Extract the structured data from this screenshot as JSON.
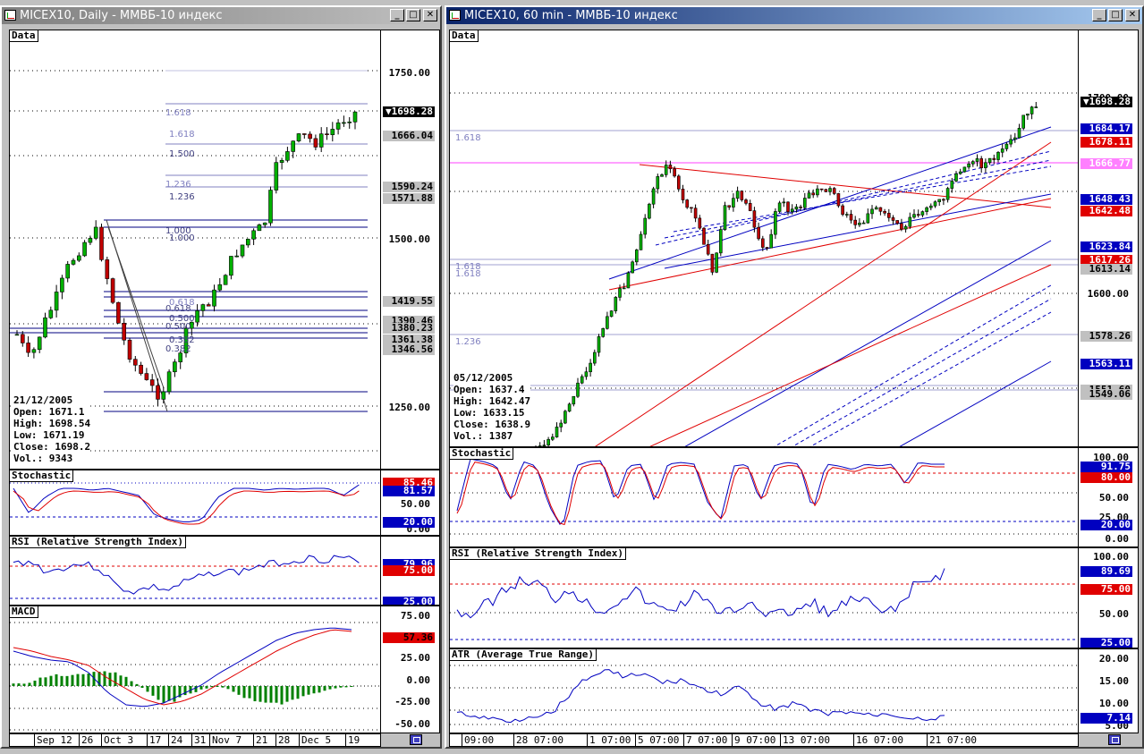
{
  "colors": {
    "active_title": "#0a246a",
    "inactive_title": "#808080",
    "bull": "#00a000",
    "bear": "#c00000",
    "blue": "#0000c0",
    "red": "#e00000"
  },
  "left": {
    "title": "MICEX10, Daily - ММВБ-10 индекс",
    "buttons": {
      "minimize": "_",
      "maximize": "□",
      "close": "✕"
    },
    "price": {
      "label": "Data",
      "ticks": [
        "1750.00",
        "1500.00",
        "1250.00"
      ],
      "badges": [
        {
          "text": "1698.28",
          "bg": "#000000",
          "fg": "#ffffff",
          "arrow": "▼"
        },
        {
          "text": "1666.04",
          "bg": "#c0c0c0",
          "fg": "#000000"
        },
        {
          "text": "1590.24",
          "bg": "#c0c0c0",
          "fg": "#000000"
        },
        {
          "text": "1571.88",
          "bg": "#c0c0c0",
          "fg": "#000000"
        },
        {
          "text": "1419.55",
          "bg": "#c0c0c0",
          "fg": "#000000"
        },
        {
          "text": "1390.46",
          "bg": "#c0c0c0",
          "fg": "#000000"
        },
        {
          "text": "1380.23",
          "bg": "#c0c0c0",
          "fg": "#000000"
        },
        {
          "text": "1361.38",
          "bg": "#c0c0c0",
          "fg": "#000000"
        },
        {
          "text": "1346.56",
          "bg": "#c0c0c0",
          "fg": "#000000"
        }
      ],
      "fib_labels": [
        "1.618",
        "1.618",
        "1.500",
        "1.236",
        "1.236",
        "1.000",
        "1.000",
        "0.618",
        "0.618",
        "0.500",
        "0.500",
        "0.382",
        "0.382"
      ],
      "ohlc": {
        "date": "21/12/2005",
        "open": "Open: 1671.1",
        "high": "High: 1698.54",
        "low": "Low: 1671.19",
        "close": "Close: 1698.2",
        "vol": "Vol.: 9343"
      }
    },
    "stoch": {
      "label": "Stochastic",
      "ticks": [
        "50.00",
        "0.00"
      ],
      "badges": [
        {
          "text": "85.46",
          "bg": "#e00000",
          "fg": "#ffffff"
        },
        {
          "text": "81.57",
          "bg": "#0000c0",
          "fg": "#ffffff"
        },
        {
          "text": "20.00",
          "bg": "#0000c0",
          "fg": "#ffffff"
        }
      ]
    },
    "rsi": {
      "label": "RSI (Relative Strength Index)",
      "badges": [
        {
          "text": "79.96",
          "bg": "#0000c0",
          "fg": "#ffffff"
        },
        {
          "text": "75.00",
          "bg": "#e00000",
          "fg": "#ffffff"
        },
        {
          "text": "25.00",
          "bg": "#0000c0",
          "fg": "#ffffff"
        }
      ]
    },
    "macd": {
      "label": "MACD",
      "ticks": [
        "75.00",
        "25.00",
        "0.00",
        "-25.00",
        "-50.00"
      ],
      "badges": [
        {
          "text": "57.36",
          "bg": "#e00000",
          "fg": "#000000"
        }
      ]
    },
    "xaxis": [
      "Sep 12",
      "26",
      "Oct 3",
      "17",
      "24",
      "31",
      "Nov 7",
      "21",
      "28",
      "Dec 5",
      "19"
    ]
  },
  "right": {
    "title": "MICEX10, 60 min - ММВБ-10 индекс",
    "buttons": {
      "minimize": "_",
      "maximize": "□",
      "close": "✕"
    },
    "price": {
      "label": "Data",
      "ticks": [
        "1700.00",
        "1600.00"
      ],
      "badges": [
        {
          "text": "1698.28",
          "bg": "#000000",
          "fg": "#ffffff",
          "arrow": "▼"
        },
        {
          "text": "1684.17",
          "bg": "#0000c0",
          "fg": "#ffffff"
        },
        {
          "text": "1678.11",
          "bg": "#e00000",
          "fg": "#ffffff"
        },
        {
          "text": "1666.77",
          "bg": "#ff80ff",
          "fg": "#ffffff"
        },
        {
          "text": "1648.43",
          "bg": "#0000c0",
          "fg": "#ffffff"
        },
        {
          "text": "1642.48",
          "bg": "#e00000",
          "fg": "#ffffff"
        },
        {
          "text": "1623.84",
          "bg": "#0000c0",
          "fg": "#ffffff"
        },
        {
          "text": "1617.26",
          "bg": "#e00000",
          "fg": "#ffffff"
        },
        {
          "text": "1613.14",
          "bg": "#c0c0c0",
          "fg": "#000000"
        },
        {
          "text": "1578.26",
          "bg": "#c0c0c0",
          "fg": "#000000"
        },
        {
          "text": "1563.11",
          "bg": "#0000c0",
          "fg": "#ffffff"
        },
        {
          "text": "1551.60",
          "bg": "#c0c0c0",
          "fg": "#000000"
        },
        {
          "text": "1549.06",
          "bg": "#c0c0c0",
          "fg": "#000000"
        }
      ],
      "fib_labels": [
        "1.618",
        "1.618",
        "1.618",
        "1.236"
      ],
      "ohlc": {
        "date": "05/12/2005",
        "open": "Open: 1637.4",
        "high": "High: 1642.47",
        "low": "Low: 1633.15",
        "close": "Close: 1638.9",
        "vol": "Vol.: 1387"
      }
    },
    "stoch": {
      "label": "Stochastic",
      "ticks": [
        "100.00",
        "50.00",
        "25.00",
        "0.00"
      ],
      "badges": [
        {
          "text": "91.75",
          "bg": "#0000c0",
          "fg": "#ffffff"
        },
        {
          "text": "80.00",
          "bg": "#e00000",
          "fg": "#ffffff"
        },
        {
          "text": "20.00",
          "bg": "#0000c0",
          "fg": "#ffffff"
        }
      ]
    },
    "rsi": {
      "label": "RSI (Relative Strength Index)",
      "ticks": [
        "100.00",
        "50.00"
      ],
      "badges": [
        {
          "text": "89.69",
          "bg": "#0000c0",
          "fg": "#ffffff"
        },
        {
          "text": "75.00",
          "bg": "#e00000",
          "fg": "#ffffff"
        },
        {
          "text": "25.00",
          "bg": "#0000c0",
          "fg": "#ffffff"
        }
      ]
    },
    "atr": {
      "label": "ATR (Average True Range)",
      "ticks": [
        "20.00",
        "15.00",
        "10.00",
        "5.00"
      ],
      "badges": [
        {
          "text": "7.14",
          "bg": "#0000c0",
          "fg": "#ffffff"
        }
      ]
    },
    "xaxis": [
      "09:00",
      "28 07:00",
      "1 07:00",
      "5 07:00",
      "7 07:00",
      "9 07:00",
      "13 07:00",
      "16 07:00",
      "21 07:00"
    ]
  }
}
